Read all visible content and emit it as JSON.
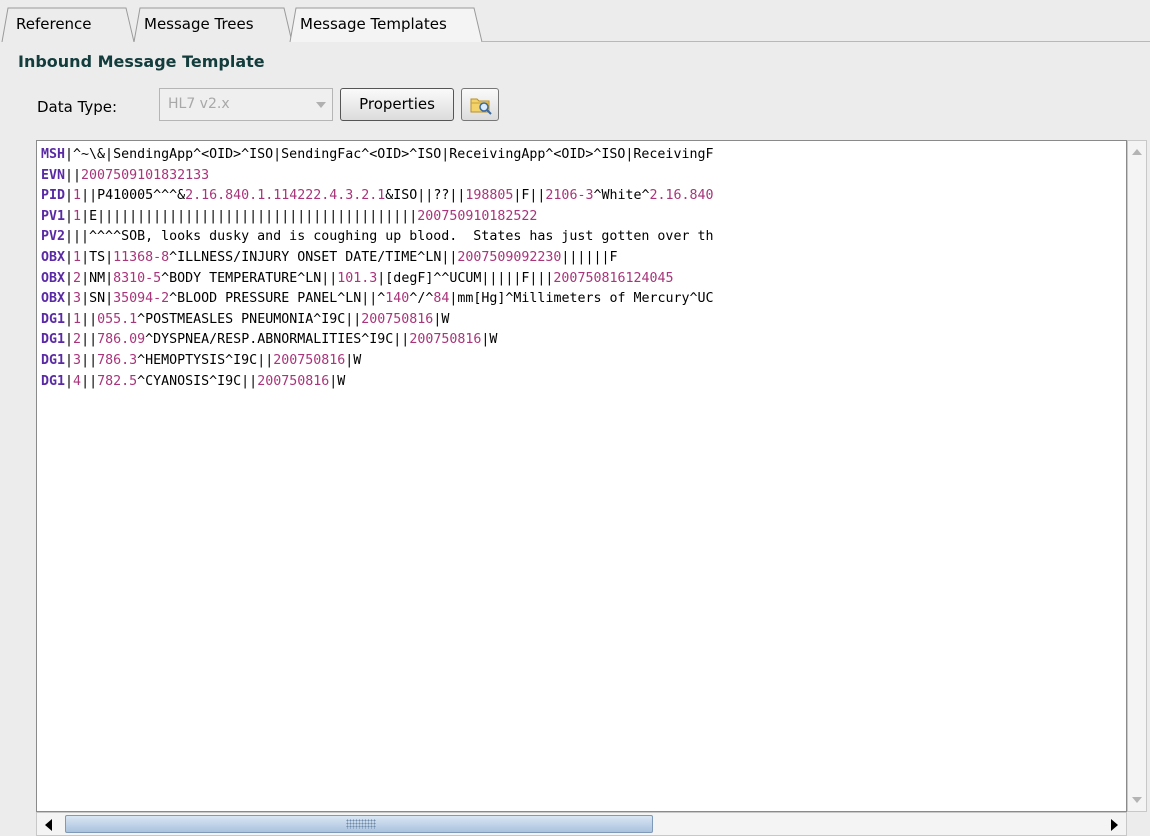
{
  "tabs": [
    {
      "label": "Reference",
      "active": false
    },
    {
      "label": "Message Trees",
      "active": false
    },
    {
      "label": "Message Templates",
      "active": true
    }
  ],
  "section_title": "Inbound Message Template",
  "data_type": {
    "label": "Data Type:",
    "value": "HL7 v2.x",
    "enabled": false
  },
  "buttons": {
    "properties": "Properties",
    "open_file_icon": "folder-search-icon"
  },
  "colors": {
    "segment_name": "#5a2aa4",
    "numeric": "#a8347a",
    "title": "#133c3c"
  },
  "message_lines": [
    [
      [
        "s",
        "MSH"
      ],
      [
        "t",
        "|^~\\&|SendingApp^<OID>^ISO|SendingFac^<OID>^ISO|ReceivingApp^<OID>^ISO|ReceivingF"
      ]
    ],
    [
      [
        "s",
        "EVN"
      ],
      [
        "t",
        "||"
      ],
      [
        "n",
        "2007509101832133"
      ]
    ],
    [
      [
        "s",
        "PID"
      ],
      [
        "t",
        "|"
      ],
      [
        "n",
        "1"
      ],
      [
        "t",
        "||P410005^^^&"
      ],
      [
        "n",
        "2.16.840.1.114222.4.3.2.1"
      ],
      [
        "t",
        "&ISO||??||"
      ],
      [
        "n",
        "198805"
      ],
      [
        "t",
        "|F||"
      ],
      [
        "n",
        "2106-3"
      ],
      [
        "t",
        "^White^"
      ],
      [
        "n",
        "2.16.840"
      ]
    ],
    [
      [
        "s",
        "PV1"
      ],
      [
        "t",
        "|"
      ],
      [
        "n",
        "1"
      ],
      [
        "t",
        "|E||||||||||||||||||||||||||||||||||||||||"
      ],
      [
        "n",
        "200750910182522"
      ]
    ],
    [
      [
        "s",
        "PV2"
      ],
      [
        "t",
        "|||^^^^SOB, looks dusky and is coughing up blood.  States has just gotten over th"
      ]
    ],
    [
      [
        "s",
        "OBX"
      ],
      [
        "t",
        "|"
      ],
      [
        "n",
        "1"
      ],
      [
        "t",
        "|TS|"
      ],
      [
        "n",
        "11368-8"
      ],
      [
        "t",
        "^ILLNESS/INJURY ONSET DATE/TIME^LN||"
      ],
      [
        "n",
        "2007509092230"
      ],
      [
        "t",
        "||||||F"
      ]
    ],
    [
      [
        "s",
        "OBX"
      ],
      [
        "t",
        "|"
      ],
      [
        "n",
        "2"
      ],
      [
        "t",
        "|NM|"
      ],
      [
        "n",
        "8310-5"
      ],
      [
        "t",
        "^BODY TEMPERATURE^LN||"
      ],
      [
        "n",
        "101.3"
      ],
      [
        "t",
        "|[degF]^^UCUM|||||F|||"
      ],
      [
        "n",
        "200750816124045"
      ]
    ],
    [
      [
        "s",
        "OBX"
      ],
      [
        "t",
        "|"
      ],
      [
        "n",
        "3"
      ],
      [
        "t",
        "|SN|"
      ],
      [
        "n",
        "35094-2"
      ],
      [
        "t",
        "^BLOOD PRESSURE PANEL^LN||^"
      ],
      [
        "n",
        "140"
      ],
      [
        "t",
        "^/^"
      ],
      [
        "n",
        "84"
      ],
      [
        "t",
        "|mm[Hg]^Millimeters of Mercury^UC"
      ]
    ],
    [
      [
        "s",
        "DG1"
      ],
      [
        "t",
        "|"
      ],
      [
        "n",
        "1"
      ],
      [
        "t",
        "||"
      ],
      [
        "n",
        "055.1"
      ],
      [
        "t",
        "^POSTMEASLES PNEUMONIA^I9C||"
      ],
      [
        "n",
        "200750816"
      ],
      [
        "t",
        "|W"
      ]
    ],
    [
      [
        "s",
        "DG1"
      ],
      [
        "t",
        "|"
      ],
      [
        "n",
        "2"
      ],
      [
        "t",
        "||"
      ],
      [
        "n",
        "786.09"
      ],
      [
        "t",
        "^DYSPNEA/RESP.ABNORMALITIES^I9C||"
      ],
      [
        "n",
        "200750816"
      ],
      [
        "t",
        "|W"
      ]
    ],
    [
      [
        "s",
        "DG1"
      ],
      [
        "t",
        "|"
      ],
      [
        "n",
        "3"
      ],
      [
        "t",
        "||"
      ],
      [
        "n",
        "786.3"
      ],
      [
        "t",
        "^HEMOPTYSIS^I9C||"
      ],
      [
        "n",
        "200750816"
      ],
      [
        "t",
        "|W"
      ]
    ],
    [
      [
        "s",
        "DG1"
      ],
      [
        "t",
        "|"
      ],
      [
        "n",
        "4"
      ],
      [
        "t",
        "||"
      ],
      [
        "n",
        "782.5"
      ],
      [
        "t",
        "^CYANOSIS^I9C||"
      ],
      [
        "n",
        "200750816"
      ],
      [
        "t",
        "|W"
      ]
    ]
  ],
  "scroll": {
    "horizontal_position": 0.0,
    "vertical_position": 0.0
  }
}
